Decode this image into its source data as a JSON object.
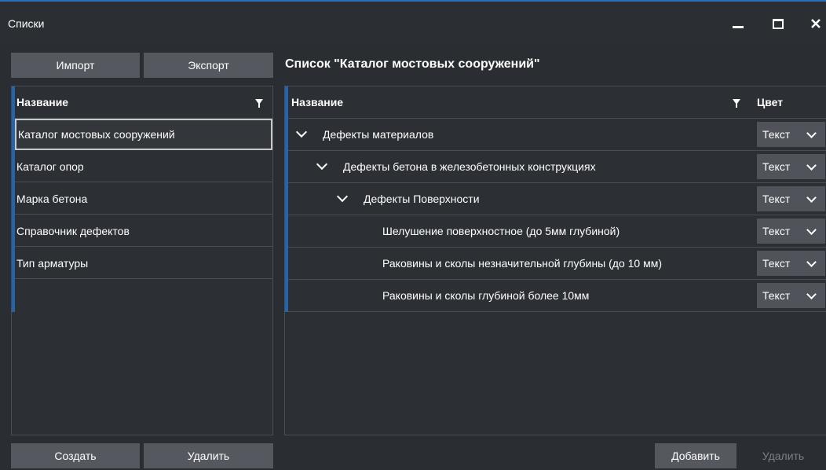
{
  "window": {
    "title": "Списки"
  },
  "left": {
    "import_label": "Импорт",
    "export_label": "Экспорт",
    "column_header": "Название",
    "items": [
      {
        "label": "Каталог мостовых сооружений",
        "selected": true
      },
      {
        "label": "Каталог опор"
      },
      {
        "label": "Марка бетона"
      },
      {
        "label": "Справочник дефектов"
      },
      {
        "label": "Тип арматуры"
      }
    ],
    "create_label": "Создать",
    "delete_label": "Удалить"
  },
  "right": {
    "title": "Список \"Каталог мостовых сооружений\"",
    "column_name": "Название",
    "column_color": "Цвет",
    "rows": [
      {
        "label": "Дефекты материалов",
        "level": 0,
        "expanded": true,
        "color": "Текст"
      },
      {
        "label": "Дефекты бетона в железобетонных конструкциях",
        "level": 1,
        "expanded": true,
        "color": "Текст"
      },
      {
        "label": "Дефекты Поверхности",
        "level": 2,
        "expanded": true,
        "color": "Текст"
      },
      {
        "label": "Шелушение поверхностное (до 5мм глубиной)",
        "level": 3,
        "color": "Текст"
      },
      {
        "label": "Раковины и сколы незначительной глубины (до 10 мм)",
        "level": 3,
        "color": "Текст"
      },
      {
        "label": "Раковины и сколы глубиной более 10мм",
        "level": 3,
        "color": "Текст"
      }
    ],
    "add_label": "Добавить",
    "delete_label": "Удалить"
  },
  "colors": {
    "accent": "#1f65b0",
    "button": "#55595f",
    "background": "#2a2d31"
  }
}
